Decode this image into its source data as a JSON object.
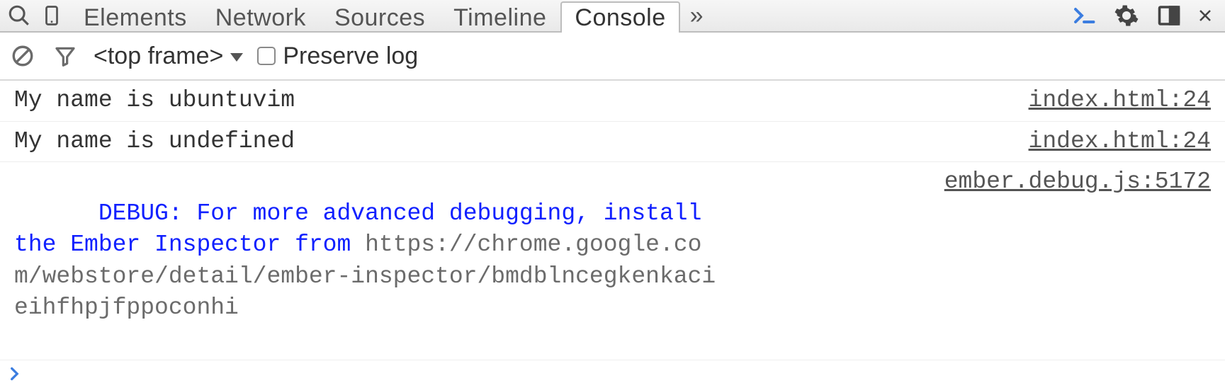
{
  "tabs": {
    "items": [
      {
        "label": "Elements",
        "active": false
      },
      {
        "label": "Network",
        "active": false
      },
      {
        "label": "Sources",
        "active": false
      },
      {
        "label": "Timeline",
        "active": false
      },
      {
        "label": "Console",
        "active": true
      }
    ],
    "overflow_glyph": "»"
  },
  "toolbar": {
    "context_label": "<top frame>",
    "preserve_log_label": "Preserve log",
    "preserve_log_checked": false
  },
  "console": {
    "rows": [
      {
        "kind": "log",
        "message": "My name is ubuntuvim",
        "source": "index.html:24"
      },
      {
        "kind": "log",
        "message": "My name is undefined",
        "source": "index.html:24"
      },
      {
        "kind": "debug",
        "message_main": "DEBUG: For more advanced debugging, install the Ember Inspector from ",
        "message_url": "https://chrome.google.com/webstore/detail/ember-inspector/bmdblncegkenkacieihfhpjfppoconhi",
        "source": "ember.debug.js:5172"
      }
    ]
  },
  "icons": {
    "search": "search-icon",
    "device": "device-icon",
    "console_shortcut": "console-shortcut-icon",
    "settings": "gear-icon",
    "dock": "dock-icon",
    "close": "close-icon",
    "clear": "clear-icon",
    "filter": "filter-icon"
  }
}
